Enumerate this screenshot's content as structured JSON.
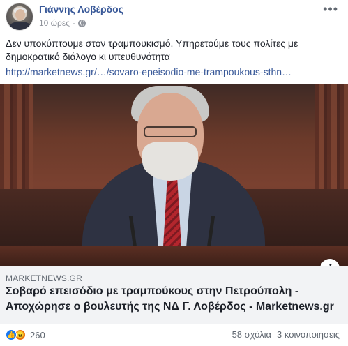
{
  "header": {
    "author_name": "Γιάννης Λοβέρδος",
    "timestamp": "10 ώρες",
    "audience_icon": "globe-icon",
    "more_icon": "more-options-icon"
  },
  "post": {
    "text": "Δεν υποκύπτουμε στον τραμπουκισμό. Υπηρετούμε τους πολίτες με δημοκρατικό διάλογο κι υπευθυνότητα",
    "link": "http://marketnews.gr/…/sovaro-epeisodio-me-trampoukous-sthn…"
  },
  "link_card": {
    "domain": "MARKETNEWS.GR",
    "title": "Σοβαρό επεισόδιο με τραμπούκους στην Πετρούπολη - Αποχώρησε ο βουλευτής της ΝΔ Γ. Λοβέρδος - Marketnews.gr",
    "info_label": "i"
  },
  "footer": {
    "reaction_count": "260",
    "comments": "58 σχόλια",
    "shares": "3 κοινοποιήσεις",
    "reaction_icons": [
      "like-icon",
      "angry-icon"
    ]
  },
  "colors": {
    "author": "#385898",
    "link": "#385898",
    "muted": "#606770",
    "caption_bg": "#f2f3f5"
  }
}
